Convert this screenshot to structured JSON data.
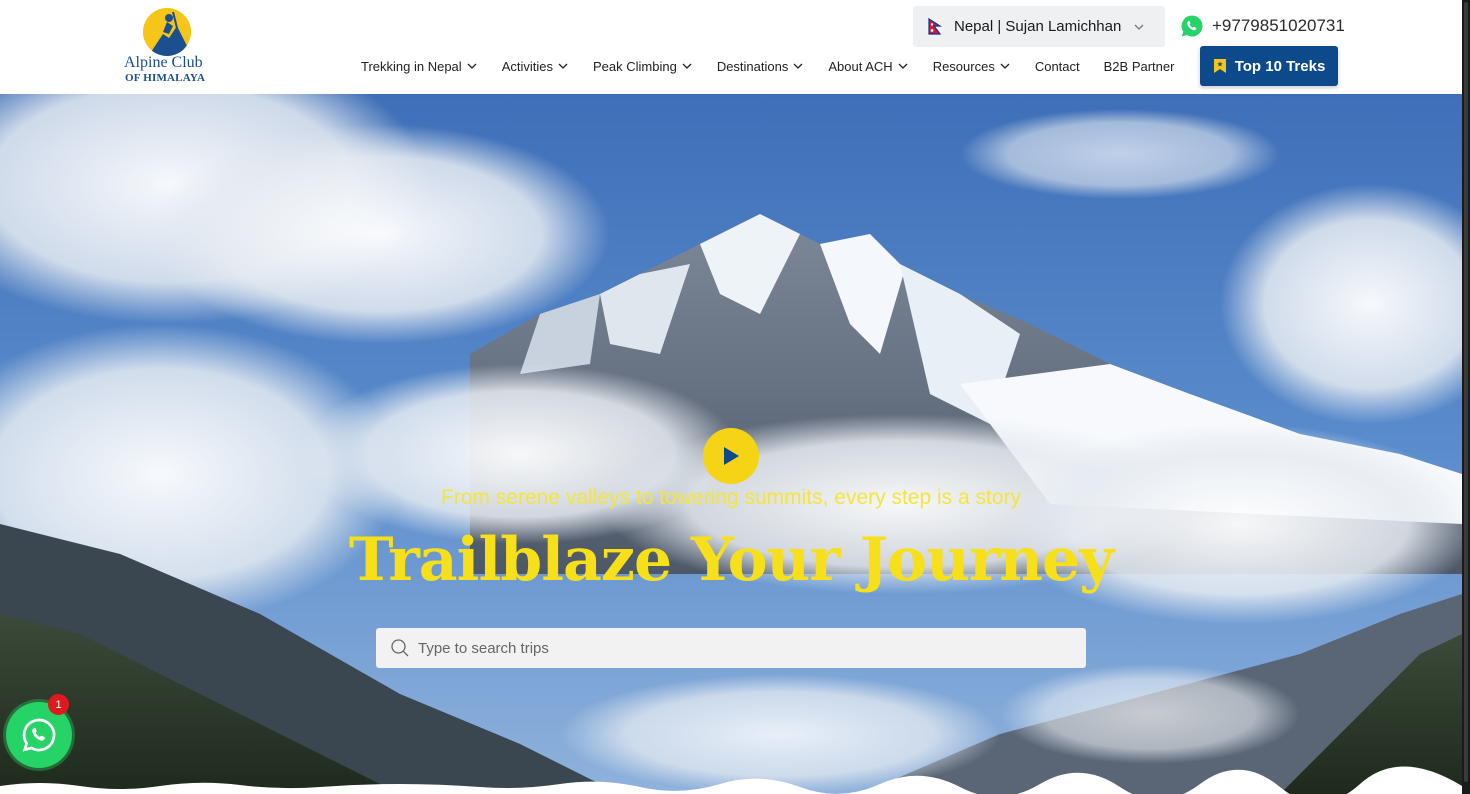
{
  "brand": {
    "line1": "Alpine Club",
    "line2": "OF HIMALAYA"
  },
  "header": {
    "region": "Nepal | Sujan Lamichhan",
    "phone": "+9779851020731",
    "top_button": "Top 10 Treks"
  },
  "nav": {
    "items": [
      {
        "label": "Trekking in Nepal",
        "dropdown": true
      },
      {
        "label": "Activities",
        "dropdown": true
      },
      {
        "label": "Peak Climbing",
        "dropdown": true
      },
      {
        "label": "Destinations",
        "dropdown": true
      },
      {
        "label": "About ACH",
        "dropdown": true
      },
      {
        "label": "Resources",
        "dropdown": true
      },
      {
        "label": "Contact",
        "dropdown": false
      },
      {
        "label": "B2B Partner",
        "dropdown": false
      }
    ]
  },
  "hero": {
    "tagline": "From serene valleys to towering summits, every step is a story",
    "headline": "Trailblaze Your Journey",
    "search_placeholder": "Type to search trips"
  },
  "whatsapp": {
    "badge": "1"
  },
  "colors": {
    "accent_yellow": "#f7e019",
    "brand_blue": "#0d4a8c",
    "whatsapp_green": "#25d366"
  },
  "icons": [
    "nepal-flag-icon",
    "chevron-down-icon",
    "whatsapp-icon",
    "bookmark-icon",
    "play-icon",
    "search-icon"
  ]
}
